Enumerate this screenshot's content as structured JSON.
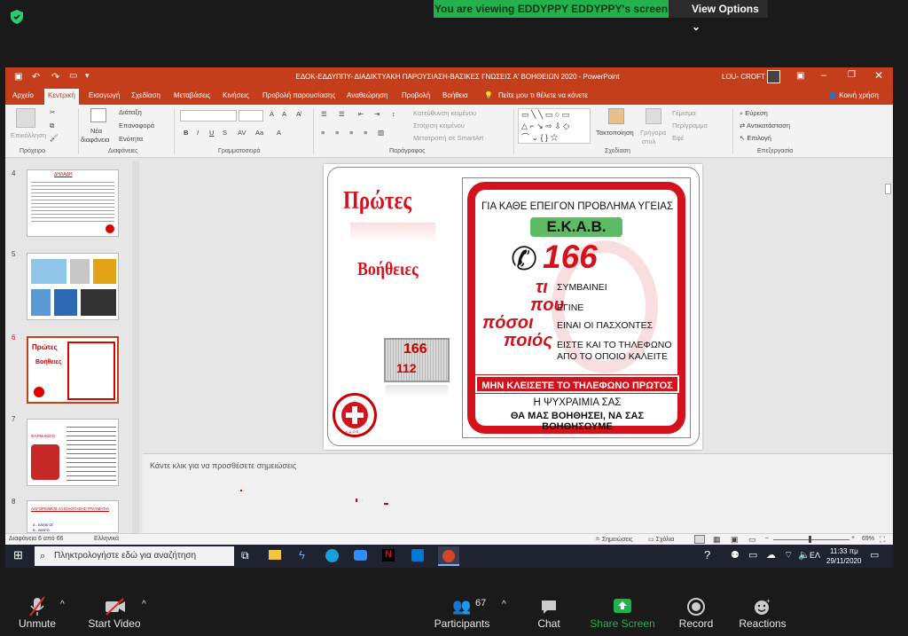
{
  "zoom": {
    "viewing_banner": "You are viewing EDDYPPY EDDYPPY's screen",
    "view_options": "View Options",
    "controls": {
      "unmute": "Unmute",
      "start_video": "Start Video",
      "participants": "Participants",
      "participants_count": "67",
      "chat": "Chat",
      "share_screen": "Share Screen",
      "record": "Record",
      "reactions": "Reactions"
    },
    "colors": {
      "banner_bg": "#22b14c",
      "share_green": "#22b14c",
      "bar_bg": "#1a1a1a"
    }
  },
  "ppt": {
    "window_title": "ΕΔΟΚ-ΕΔΔΥΠΠΥ- ΔΙΑΔΙΚΤΥΑΚΗ ΠΑΡΟΥΣΙΑΣΗ-ΒΑΣΙΚΕΣ ΓΝΩΣΕΙΣ Α' ΒΟΗΘΕΙΩΝ 2020 - PowerPoint",
    "user": "LOU- CROFT",
    "tabs": [
      "Αρχείο",
      "Κεντρική",
      "Εισαγωγή",
      "Σχεδίαση",
      "Μεταβάσεις",
      "Κινήσεις",
      "Προβολή παρουσίασης",
      "Αναθεώρηση",
      "Προβολή",
      "Βοήθεια"
    ],
    "tell_me": "Πείτε μου τι θέλετε να κάνετε",
    "share": "Κοινή χρήση",
    "ribbon": {
      "paste": "Επικόλληση",
      "new_slide_1": "Νέα",
      "new_slide_2": "διαφάνεια",
      "layout": "Διάταξη",
      "reset": "Επαναφορά",
      "section": "Ενότητα",
      "text_direction": "Κατεύθυνση κειμένου",
      "align_text": "Στοίχιση κειμένου",
      "smartart": "Μετατροπή σε SmartArt",
      "arrange": "Τακτοποίηση",
      "quick_styles_1": "Γρήγορα",
      "quick_styles_2": "στυλ",
      "fill": "Γέμισμα",
      "outline": "Περίγραμμα",
      "effects": "Εφέ",
      "find": "Εύρεση",
      "replace": "Αντικατάσταση",
      "select": "Επιλογή",
      "groups": {
        "clipboard": "Πρόχειρο",
        "slides": "Διαφάνειες",
        "font": "Γραμματοσειρά",
        "paragraph": "Παράγραφος",
        "drawing": "Σχεδίαση",
        "editing": "Επεξεργασία"
      }
    },
    "thumb_numbers": [
      "4",
      "5",
      "6",
      "7",
      "8"
    ],
    "thumb4": {
      "title": "ΔΗΛΑΔΗ"
    },
    "thumb7": {
      "title": "ΦΑΡΜΑΚΕΙΟ"
    },
    "thumb8": {
      "title": "ΑΛΓΟΡΙΘΜΟΣ ΑΞΙΟΛΟΓΗΣΗΣ ΤΡΑΥΜΑΤΙΑ",
      "line1": "Α - ΑΕΡΑΓΩΓ",
      "line2": "Β - ΒΙΘΡΩ"
    },
    "slide": {
      "left_title_1": "Πρώτες",
      "left_title_2": "Βοήθειες",
      "num_166": "166",
      "num_112": "112",
      "logo_text": "Ε.Δ.Ο.Κ",
      "header": "ΓΙΑ ΚΑΘΕ ΕΠΕΙΓΟΝ ΠΡΟΒΛΗΜΑ ΥΓΕΙΑΣ",
      "ekab": "Ε.Κ.Α.Β.",
      "phone_number": "166",
      "q_ti": "τι",
      "q_pou": "που",
      "q_posoi": "πόσοι",
      "q_poios": "ποιός",
      "a1": "ΣΥΜΒΑΙΝΕΙ",
      "a2": "ΕΓΙΝΕ",
      "a3": "ΕΙΝΑΙ ΟΙ ΠΑΣΧΟΝΤΕΣ",
      "a4": "ΕΙΣΤΕ ΚΑΙ ΤΟ ΤΗΛΕΦΩΝΟ",
      "a5": "ΑΠΟ ΤΟ ΟΠΟΙΟ ΚΑΛΕΙΤΕ",
      "banner": "ΜΗΝ ΚΛΕΙΣΕΤΕ ΤΟ ΤΗΛΕΦΩΝΟ ΠΡΩΤΟΣ",
      "footer1": "Η ΨΥΧΡΑΙΜΙΑ ΣΑΣ",
      "footer2": "ΘΑ ΜΑΣ ΒΟΗΘΗΣΕΙ, ΝΑ ΣΑΣ ΒΟΗΘΗΣΟΥΜΕ",
      "colors": {
        "red": "#d4121c",
        "green": "#5dbb63"
      }
    },
    "notes_placeholder": "Κάντε κλικ για να προσθέσετε σημειώσεις",
    "status": {
      "slide_of": "Διαφάνεια 6 από 66",
      "language": "Ελληνικά",
      "notes": "Σημειώσεις",
      "comments": "Σχόλια",
      "zoom_pct": "69%"
    }
  },
  "taskbar": {
    "search_placeholder": "Πληκτρολογήστε εδώ για αναζήτηση",
    "lang": "ΕΛ",
    "time": "11:33 πμ",
    "date": "29/11/2020"
  }
}
